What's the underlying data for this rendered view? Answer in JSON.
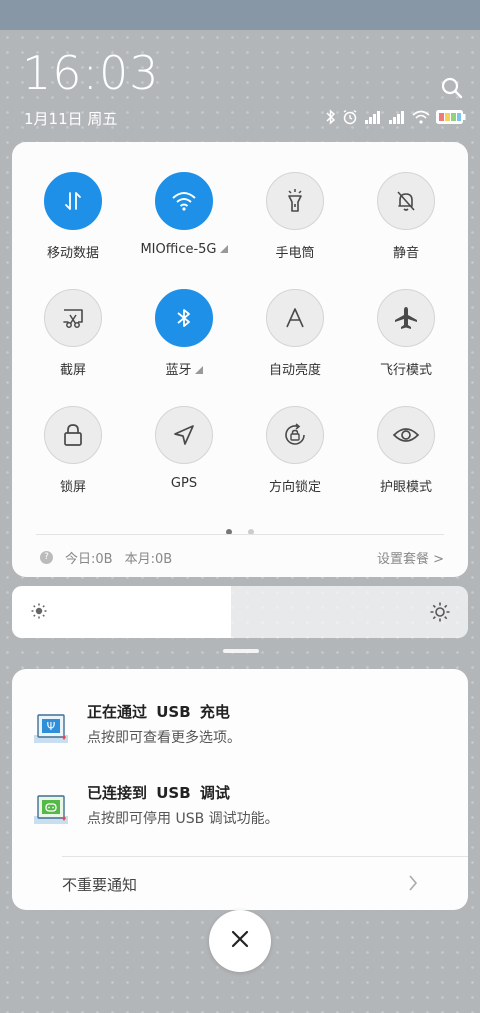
{
  "lock": {
    "time": "16:03",
    "date": "1月11日 周五"
  },
  "tiles": [
    {
      "label": "移动数据",
      "icon": "mobile-data-icon",
      "on": true
    },
    {
      "label": "MIOffice-5G",
      "icon": "wifi-icon",
      "on": true,
      "expand": true
    },
    {
      "label": "手电筒",
      "icon": "flashlight-icon",
      "on": false
    },
    {
      "label": "静音",
      "icon": "mute-bell-icon",
      "on": false
    },
    {
      "label": "截屏",
      "icon": "screenshot-icon",
      "on": false
    },
    {
      "label": "蓝牙",
      "icon": "bluetooth-icon",
      "on": true,
      "expand": true
    },
    {
      "label": "自动亮度",
      "icon": "auto-brightness-icon",
      "on": false
    },
    {
      "label": "飞行模式",
      "icon": "airplane-icon",
      "on": false
    },
    {
      "label": "锁屏",
      "icon": "lock-icon",
      "on": false
    },
    {
      "label": "GPS",
      "icon": "gps-icon",
      "on": false
    },
    {
      "label": "方向锁定",
      "icon": "rotation-lock-icon",
      "on": false
    },
    {
      "label": "护眼模式",
      "icon": "eye-icon",
      "on": false
    }
  ],
  "usage": {
    "today": "今日:0B",
    "month": "本月:0B",
    "settings": "设置套餐 >"
  },
  "pager": {
    "pages": 2,
    "current": 1
  },
  "brightness": {
    "level": 0.48
  },
  "notifications": [
    {
      "title": "正在通过 USB 充电",
      "desc": "点按即可查看更多选项。",
      "icon": "usb-charge-icon"
    },
    {
      "title": "已连接到 USB 调试",
      "desc": "点按即可停用 USB 调试功能。",
      "icon": "usb-debug-icon"
    }
  ],
  "unimportant": "不重要通知",
  "colors": {
    "accent": "#1e90e8",
    "topbar": "#8797a6"
  }
}
